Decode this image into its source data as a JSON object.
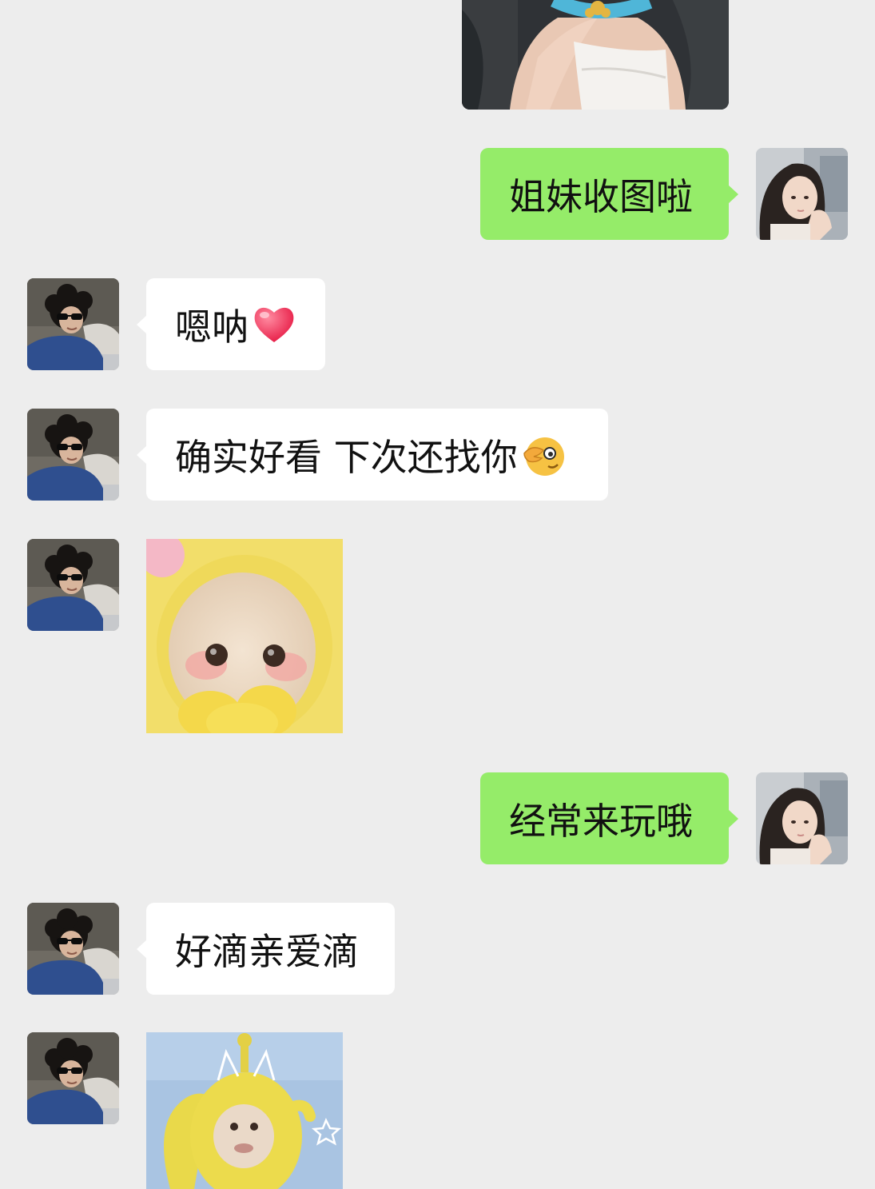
{
  "messages": [
    {
      "id": "m0",
      "side": "out",
      "kind": "image",
      "image": "photo-woman-white-dress"
    },
    {
      "id": "m1",
      "side": "out",
      "kind": "text",
      "text": "姐妹收图啦"
    },
    {
      "id": "m2",
      "side": "in",
      "kind": "text",
      "text": "嗯呐",
      "emoji": "red-heart-emoji"
    },
    {
      "id": "m3",
      "side": "in",
      "kind": "text",
      "text": "确实好看 下次还找你",
      "emoji": "winking-face-hand-emoji"
    },
    {
      "id": "m4",
      "side": "in",
      "kind": "sticker",
      "image": "yellow-teletubby-face-sticker"
    },
    {
      "id": "m5",
      "side": "out",
      "kind": "text",
      "text": "经常来玩哦"
    },
    {
      "id": "m6",
      "side": "in",
      "kind": "text",
      "text": "好滴亲爱滴"
    },
    {
      "id": "m7",
      "side": "in",
      "kind": "sticker",
      "image": "yellow-teletubby-waving-sticker"
    }
  ],
  "avatars": {
    "self": "girl-long-hair-avatar",
    "contact": "curly-hair-sunglasses-avatar"
  },
  "colors": {
    "background": "#ededed",
    "incoming_bubble": "#ffffff",
    "outgoing_bubble": "#95ec69",
    "text": "#111111"
  }
}
